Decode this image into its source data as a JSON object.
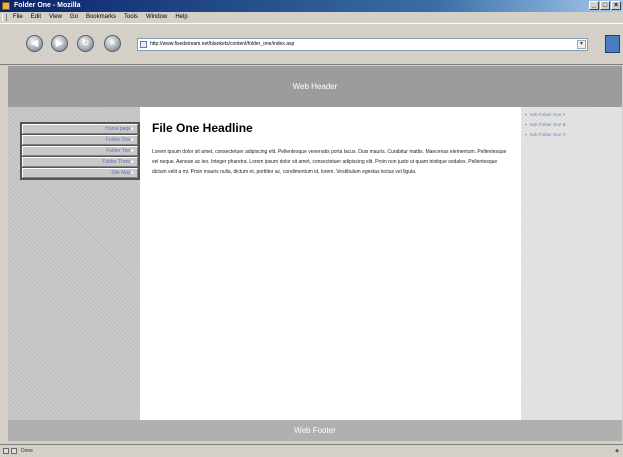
{
  "window": {
    "title": "Folder One - Mozilla",
    "controls": [
      "_",
      "□",
      "×"
    ]
  },
  "menu": [
    "File",
    "Edit",
    "View",
    "Go",
    "Bookmarks",
    "Tools",
    "Window",
    "Help"
  ],
  "nav_buttons": [
    {
      "name": "back",
      "glyph": "◀"
    },
    {
      "name": "forward",
      "glyph": "▶"
    },
    {
      "name": "reload",
      "glyph": "↻"
    },
    {
      "name": "stop",
      "glyph": "×"
    }
  ],
  "address": {
    "url": "http://www.fixedstream.net/blankets/content/folder_one/index.asp"
  },
  "page": {
    "header": "Web Header",
    "footer": "Web Footer",
    "left_nav": [
      "Home page",
      "Folder One",
      "Folder Two",
      "Folder Three",
      "Site Map"
    ],
    "headline": "File One Headline",
    "body": "Lorem ipsum dolor sit amet, consectetuer adipiscing elit. Pellentesque venenatis porta lacus. Duis mauris. Curabitur mattis. Maecenas elementum. Pellentesque vel neque. Aenean ac leo. Integer pharetra. Lorem ipsum dolor sit amet, consectetuer adipiscing elit. Proin non justo ut quam tristique sodales. Pellentesque dictum velit a mi. Proin mauris nulla, dictum et, porttitor ac, condimentum id, lorem. Vestibulum egestas lectus vel ligula.",
    "sub_links": [
      "Sub Folder One A",
      "Sub Folder One B",
      "Sub Folder One C"
    ]
  },
  "status": {
    "text": "Done"
  }
}
